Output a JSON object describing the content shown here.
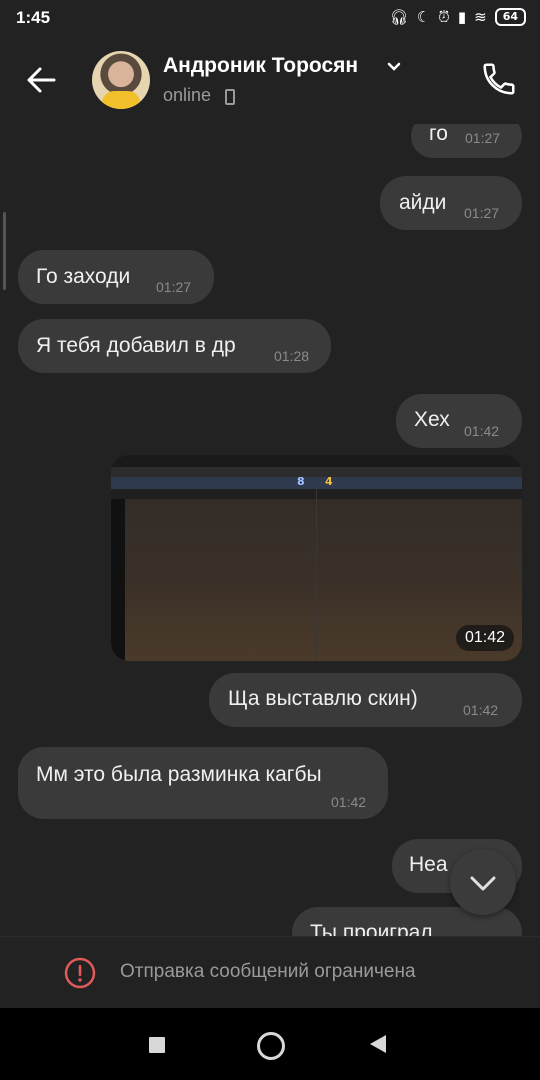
{
  "status_bar": {
    "time": "1:45",
    "battery": "64"
  },
  "header": {
    "contact_name": "Андроник Торосян",
    "presence": "online"
  },
  "messages": [
    {
      "side": "out",
      "text": "го",
      "time": "01:27"
    },
    {
      "side": "out",
      "text": "айди",
      "time": "01:27"
    },
    {
      "side": "in",
      "text": "Го заходи",
      "time": "01:27"
    },
    {
      "side": "in",
      "text": "Я тебя добавил в др",
      "time": "01:28"
    },
    {
      "side": "out",
      "text": "Хех",
      "time": "01:42"
    },
    {
      "side": "out",
      "type": "image",
      "time": "01:42",
      "preview_text": {
        "score_ct": "8",
        "score_t": "4"
      }
    },
    {
      "side": "out",
      "text": "Ща выставлю скин)",
      "time": "01:42"
    },
    {
      "side": "in",
      "text": "Мм это была разминка кагбы",
      "time": "01:42"
    },
    {
      "side": "out",
      "text": "Неа",
      "time": ""
    },
    {
      "side": "out",
      "text": "Ты проиграл",
      "time": ""
    }
  ],
  "footer": {
    "restriction_text": "Отправка сообщений ограничена"
  },
  "icons": [
    "back-arrow-icon",
    "chevron-down-icon",
    "phone-icon",
    "call-icon",
    "warning-icon",
    "chevron-down-icon",
    "nav-square-icon",
    "nav-home-icon",
    "nav-back-icon"
  ],
  "colors": {
    "background": "#222222",
    "bubble": "#3a3a3a",
    "warning": "#e05a5a"
  }
}
